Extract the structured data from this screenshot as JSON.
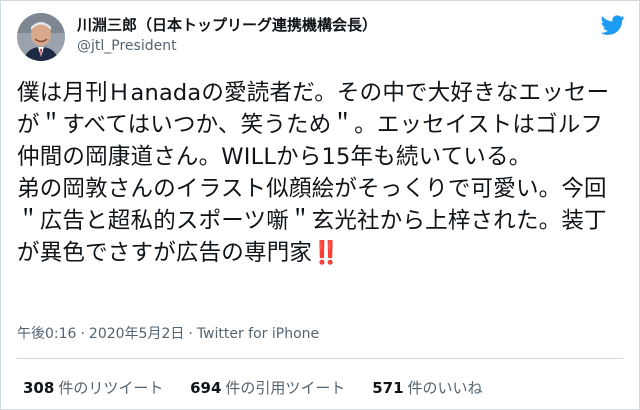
{
  "user": {
    "display_name": "川淵三郎（日本トップリーグ連携機構会長）",
    "handle": "@jtl_President",
    "avatar_icon": "avatar-photo",
    "logo_icon": "twitter-bird-icon"
  },
  "tweet": {
    "text": "僕は月刊Ｈanadaの愛読者だ。その中で大好きなエッセーが＂すべてはいつか、笑うため＂。エッセイストはゴルフ仲間の岡康道さん。WILLから15年も続いている。\n弟の岡敦さんのイラスト似顔絵がそっくりで可愛い。今回＂広告と超私的スポーツ噺＂玄光社から上梓された。装丁が異色でさすが広告の専門家",
    "emoji": "‼️"
  },
  "meta": {
    "time": "午後0:16",
    "date": "2020年5月2日",
    "separator": "·",
    "source": "Twitter for iPhone"
  },
  "stats": {
    "retweets_count": "308",
    "retweets_label": "件のリツイート",
    "quotes_count": "694",
    "quotes_label": "件の引用ツイート",
    "likes_count": "571",
    "likes_label": "件のいいね"
  },
  "colors": {
    "text": "#0f1419",
    "secondary": "#536471",
    "twitter_blue": "#1d9bf0",
    "border": "#cfd9de"
  }
}
